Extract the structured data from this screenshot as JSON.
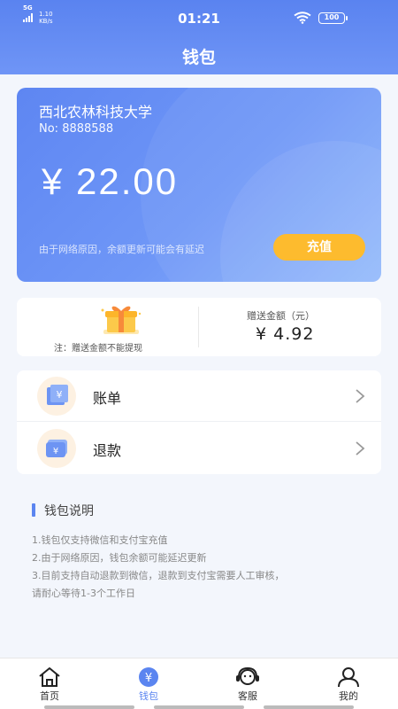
{
  "status_bar": {
    "network": "5G",
    "speed_value": "1.10",
    "speed_unit": "KB/s",
    "time": "01:21",
    "battery": "100"
  },
  "header": {
    "title": "钱包"
  },
  "wallet": {
    "school_name": "西北农林科技大学",
    "card_number": "No: 8888588",
    "balance": "¥ 22.00",
    "delay_note": "由于网络原因，余额更新可能会有延迟",
    "recharge_label": "充值"
  },
  "bonus": {
    "note": "注：赠送金额不能提现",
    "label": "赠送金额（元）",
    "amount": "¥ 4.92"
  },
  "menu": {
    "items": [
      {
        "label": "账单",
        "icon": "bill-icon"
      },
      {
        "label": "退款",
        "icon": "refund-icon"
      }
    ]
  },
  "info": {
    "title": "钱包说明",
    "lines": [
      "1.钱包仅支持微信和支付宝充值",
      "2.由于网络原因，钱包余额可能延迟更新",
      "3.目前支持自动退款到微信，退款到支付宝需要人工审核，",
      "请耐心等待1-3个工作日"
    ]
  },
  "tabbar": {
    "items": [
      {
        "label": "首页",
        "icon": "home-icon",
        "active": false
      },
      {
        "label": "钱包",
        "icon": "wallet-icon",
        "active": true
      },
      {
        "label": "客服",
        "icon": "customer-service-icon",
        "active": false
      },
      {
        "label": "我的",
        "icon": "user-icon",
        "active": false
      }
    ]
  },
  "colors": {
    "accent": "#5b85f0",
    "recharge": "#fdbb2e",
    "background": "#f3f6fc"
  }
}
